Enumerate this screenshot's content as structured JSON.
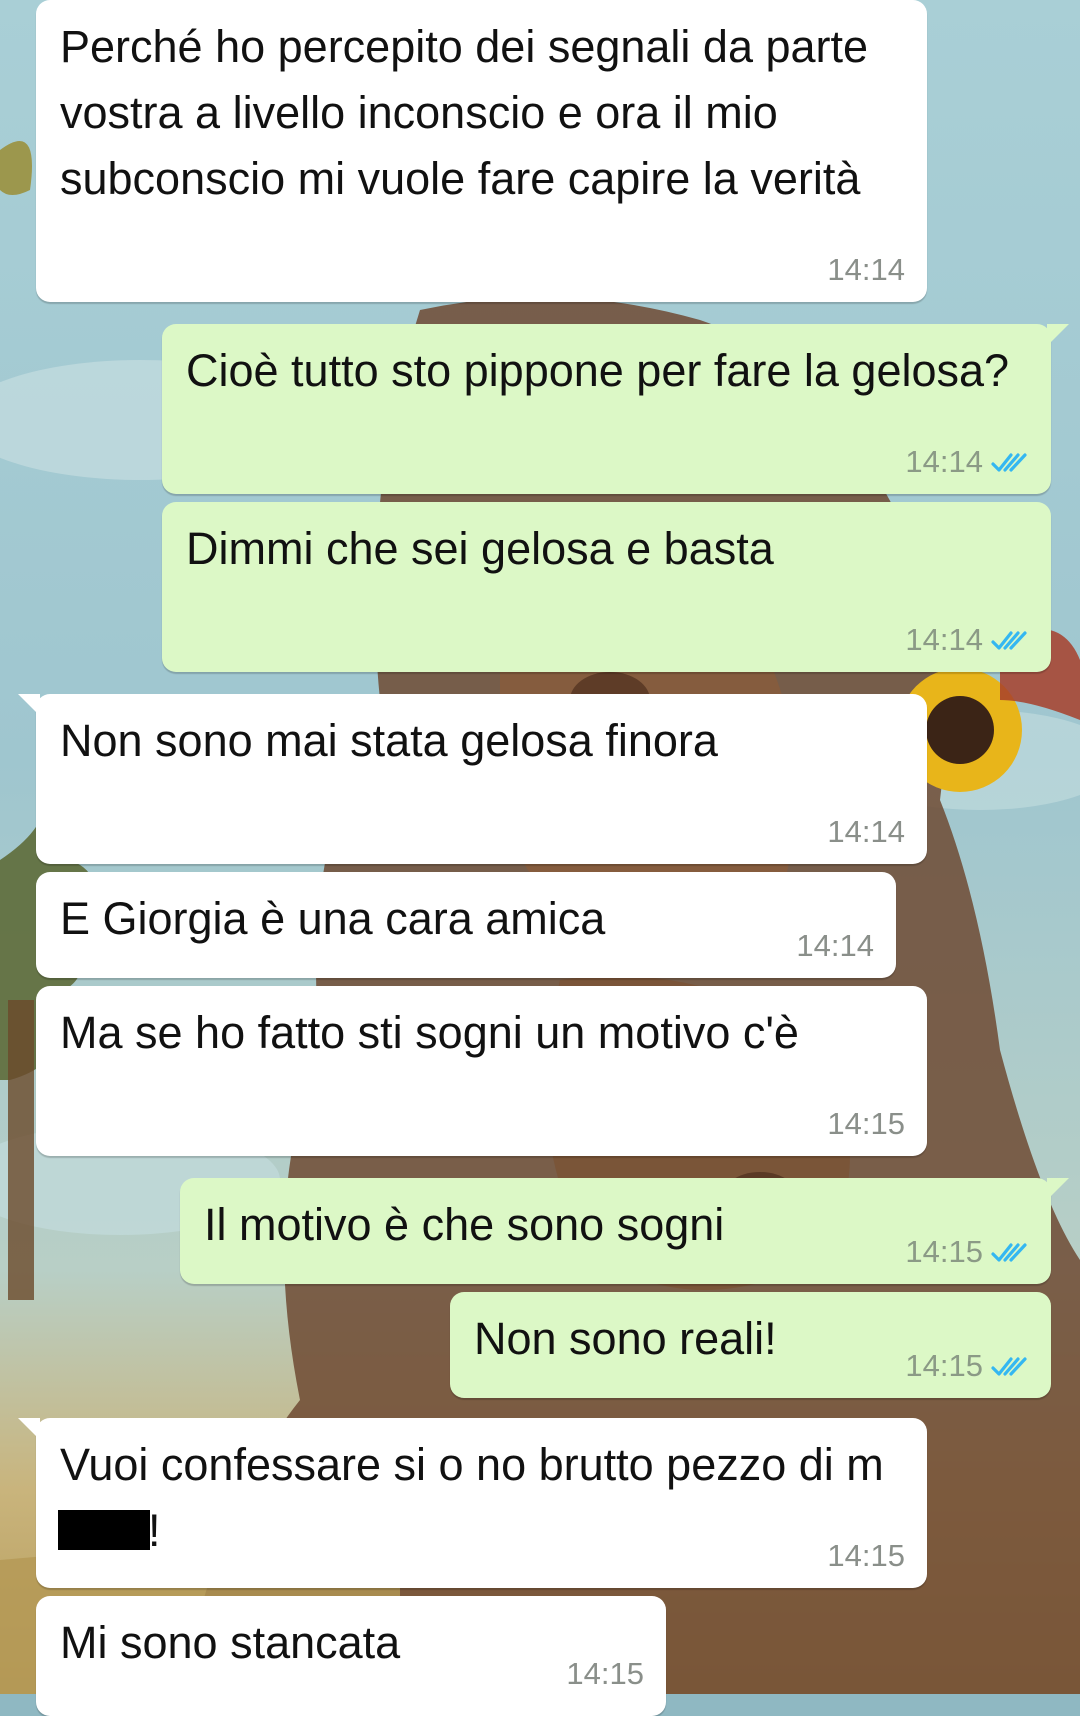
{
  "colors": {
    "incoming_bubble": "#ffffff",
    "outgoing_bubble": "#dcf8c6",
    "timestamp": "#8a8f8a",
    "read_ticks": "#34b7f1"
  },
  "messages": [
    {
      "direction": "incoming",
      "text": "Perché ho percepito dei segnali da parte vostra a livello inconscio e ora il mio subconscio mi vuole fare capire la verità",
      "time": "14:14"
    },
    {
      "direction": "outgoing",
      "text": "Cioè tutto sto pippone per fare la gelosa?",
      "time": "14:14",
      "status_icon": "double-check-read-icon"
    },
    {
      "direction": "outgoing",
      "text": "Dimmi che sei gelosa e basta",
      "time": "14:14",
      "status_icon": "double-check-read-icon"
    },
    {
      "direction": "incoming",
      "text": "Non sono mai stata gelosa finora",
      "time": "14:14"
    },
    {
      "direction": "incoming",
      "text": "E Giorgia è una cara amica",
      "time": "14:14"
    },
    {
      "direction": "incoming",
      "text": "Ma se ho fatto sti sogni un motivo c'è",
      "time": "14:15"
    },
    {
      "direction": "outgoing",
      "text": "Il motivo è che sono sogni",
      "time": "14:15",
      "status_icon": "double-check-read-icon"
    },
    {
      "direction": "outgoing",
      "text": "Non sono reali!",
      "time": "14:15",
      "status_icon": "double-check-read-icon"
    },
    {
      "direction": "incoming",
      "text_before_redaction": "Vuoi confessare si o no brutto pezzo di m",
      "text_after_redaction": "!",
      "time": "14:15"
    },
    {
      "direction": "incoming",
      "text": "Mi sono stancata",
      "time": "14:15"
    }
  ]
}
